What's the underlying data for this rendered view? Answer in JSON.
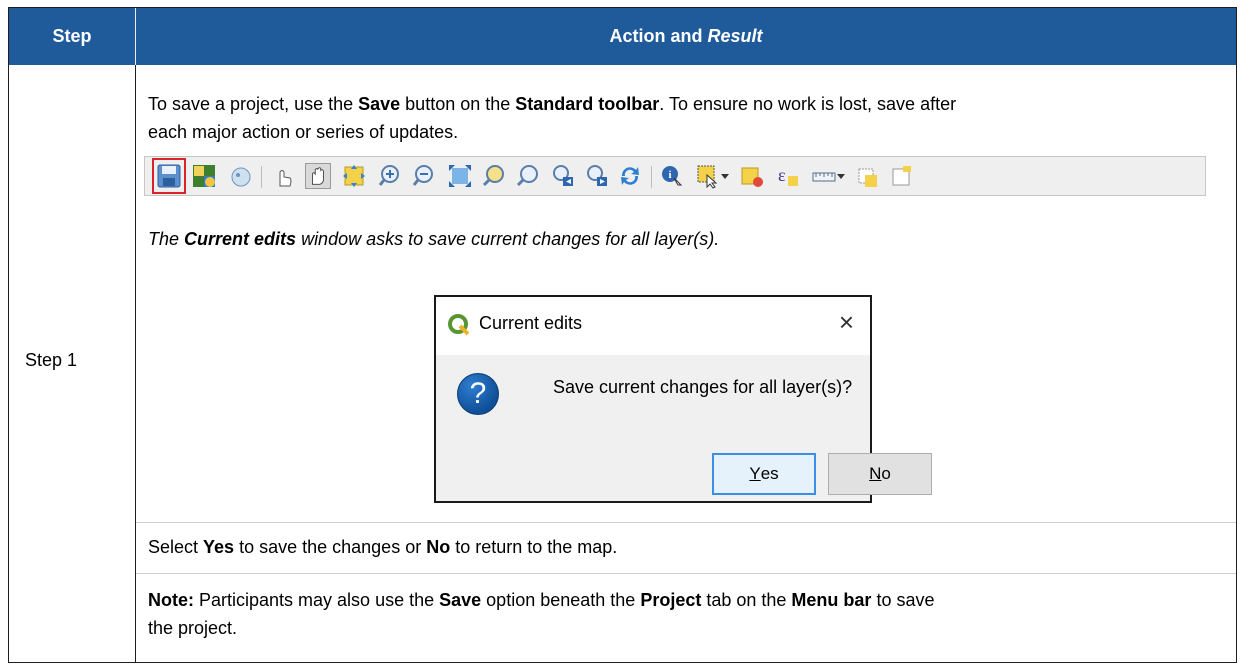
{
  "header": {
    "step_col": "Step",
    "action_col_prefix": "Action and ",
    "action_col_italic": "Result"
  },
  "step_label": "Step 1",
  "para1": {
    "t1": "To save a project, use the ",
    "b1": "Save",
    "t2": " button on the ",
    "b2": "Standard toolbar",
    "t3": ". To ensure no work is lost, save after",
    "line2": "each major action or series of updates."
  },
  "toolbar": {
    "icons": [
      "save-project-icon",
      "new-print-layout-icon",
      "style-manager-icon",
      "touch-zoom-icon",
      "pan-icon",
      "pan-to-selection-icon",
      "zoom-in-icon",
      "zoom-out-icon",
      "zoom-full-icon",
      "zoom-to-selection-icon",
      "zoom-to-layer-icon",
      "zoom-last-icon",
      "zoom-next-icon",
      "refresh-icon",
      "identify-icon",
      "select-features-icon",
      "deselect-icon",
      "select-by-expression-icon",
      "measure-icon",
      "new-bookmark-icon",
      "show-bookmarks-icon"
    ]
  },
  "para2": {
    "t1": "The ",
    "b1": "Current edits",
    "t2": " window asks to save current changes for all layer(s)."
  },
  "dialog": {
    "title": "Current edits",
    "close": "×",
    "message": "Save current changes for all layer(s)?",
    "icon": "?",
    "yes_u": "Y",
    "yes_rest": "es",
    "no_u": "N",
    "no_rest": "o"
  },
  "para3": {
    "t1": "Select ",
    "b1": "Yes",
    "t2": " to save the changes or ",
    "b2": "No",
    "t3": " to return to the map."
  },
  "para4": {
    "b0": "Note:",
    "t1": " Participants may also use the ",
    "b1": "Save",
    "t2": " option beneath the ",
    "b2": "Project",
    "t3": " tab on the ",
    "b3": "Menu bar",
    "t4": " to save",
    "line2": "the project."
  },
  "colors": {
    "header_bg": "#1f5a9a",
    "highlight": "#d8232a"
  }
}
